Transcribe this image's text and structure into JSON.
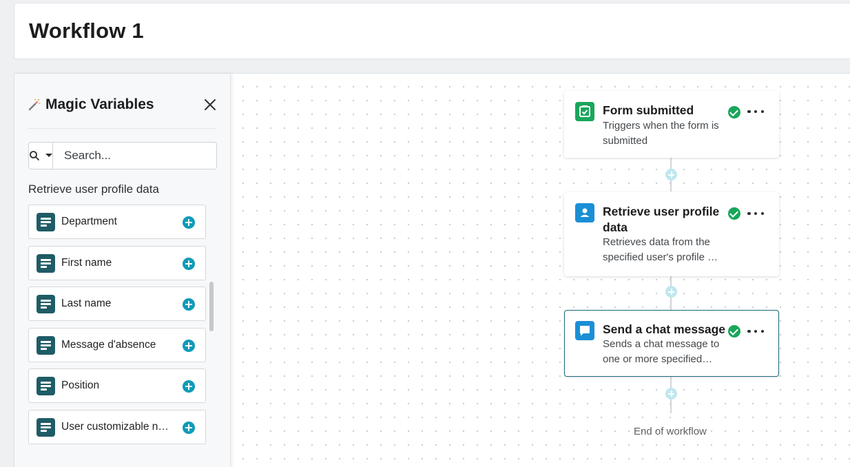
{
  "header": {
    "title": "Workflow 1"
  },
  "sidebar": {
    "title": "Magic Variables",
    "search": {
      "placeholder": "Search..."
    },
    "section_label": "Retrieve user profile data",
    "items": [
      {
        "label": "Department"
      },
      {
        "label": "First name"
      },
      {
        "label": "Last name"
      },
      {
        "label": "Message d'absence"
      },
      {
        "label": "Position"
      },
      {
        "label": "User customizable na…"
      }
    ]
  },
  "workflow": {
    "steps": [
      {
        "title": "Form submitted",
        "description": "Triggers when the form is submitted",
        "status": "complete",
        "icon": "form-check-icon",
        "color": "#1aa65c"
      },
      {
        "title": "Retrieve user profile data",
        "description": "Retrieves data from the specified user's profile …",
        "status": "complete",
        "icon": "user-icon",
        "color": "#1b8fd6"
      },
      {
        "title": "Send a chat message",
        "description": "Sends a chat message to one or more specified…",
        "status": "complete",
        "icon": "chat-icon",
        "color": "#1b8fd6",
        "selected": true
      }
    ],
    "end_label": "End of workflow"
  },
  "colors": {
    "accent": "#0f9bb9",
    "success": "#1aa65c",
    "variable_icon": "#1f5c66"
  }
}
